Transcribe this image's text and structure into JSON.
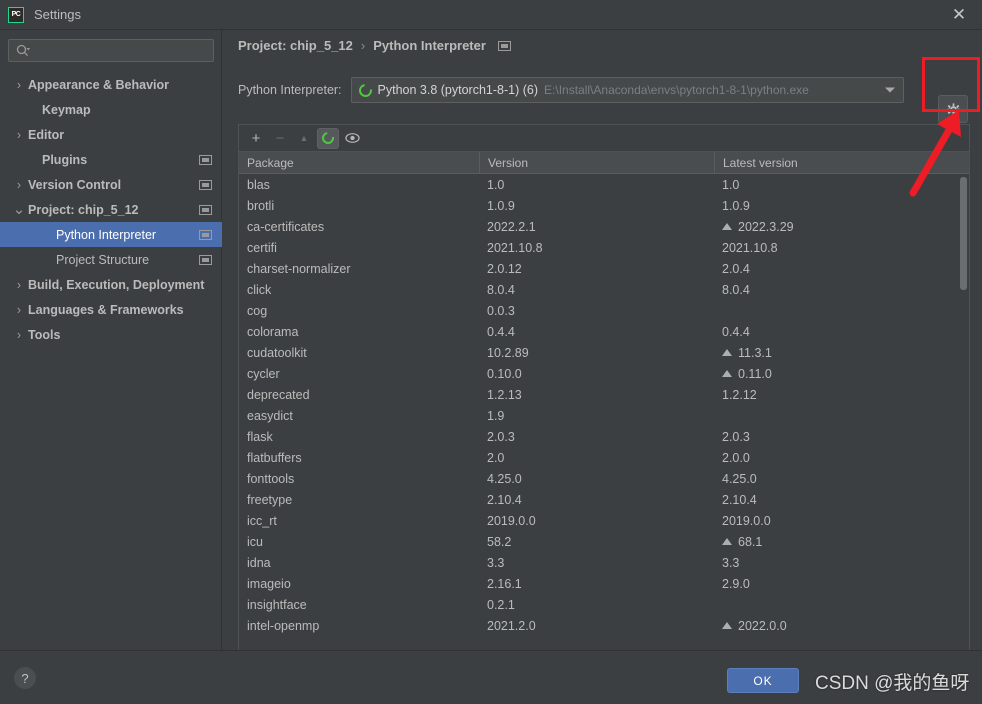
{
  "window": {
    "app_icon": "pycharm-logo-icon",
    "title": "Settings",
    "close_label": "✕"
  },
  "sidebar": {
    "search": {
      "placeholder": "",
      "value": "",
      "icon": "search-icon"
    },
    "items": [
      {
        "label": "Appearance & Behavior",
        "arrow": "›",
        "indent": 0,
        "bold": true,
        "scope_icon": false,
        "selected": false
      },
      {
        "label": "Keymap",
        "arrow": "",
        "indent": 1,
        "bold": true,
        "scope_icon": false,
        "selected": false
      },
      {
        "label": "Editor",
        "arrow": "›",
        "indent": 0,
        "bold": true,
        "scope_icon": false,
        "selected": false
      },
      {
        "label": "Plugins",
        "arrow": "",
        "indent": 1,
        "bold": true,
        "scope_icon": true,
        "selected": false
      },
      {
        "label": "Version Control",
        "arrow": "›",
        "indent": 0,
        "bold": true,
        "scope_icon": true,
        "selected": false
      },
      {
        "label": "Project: chip_5_12",
        "arrow": "⌄",
        "indent": 0,
        "bold": true,
        "scope_icon": true,
        "selected": false
      },
      {
        "label": "Python Interpreter",
        "arrow": "",
        "indent": 2,
        "bold": false,
        "scope_icon": true,
        "selected": true
      },
      {
        "label": "Project Structure",
        "arrow": "",
        "indent": 2,
        "bold": false,
        "scope_icon": true,
        "selected": false
      },
      {
        "label": "Build, Execution, Deployment",
        "arrow": "›",
        "indent": 0,
        "bold": true,
        "scope_icon": false,
        "selected": false
      },
      {
        "label": "Languages & Frameworks",
        "arrow": "›",
        "indent": 0,
        "bold": true,
        "scope_icon": false,
        "selected": false
      },
      {
        "label": "Tools",
        "arrow": "›",
        "indent": 0,
        "bold": true,
        "scope_icon": false,
        "selected": false
      }
    ]
  },
  "content": {
    "breadcrumb": {
      "root": "Project: chip_5_12",
      "separator": "›",
      "current": "Python Interpreter",
      "scope_icon": "project-scope-icon"
    },
    "interpreter": {
      "label": "Python Interpreter:",
      "icon": "conda-env-icon",
      "name": "Python 3.8 (pytorch1-8-1) (6)",
      "path": "E:\\Install\\Anaconda\\envs\\pytorch1-8-1\\python.exe",
      "dropdown_icon": "chevron-down-icon",
      "settings_icon": "gear-icon"
    },
    "toolbar": [
      {
        "icon": "plus-icon",
        "glyph": "+",
        "state": "enabled"
      },
      {
        "icon": "minus-icon",
        "glyph": "−",
        "state": "disabled"
      },
      {
        "icon": "upgrade-icon",
        "glyph": "▲",
        "state": "disabled"
      },
      {
        "icon": "conda-env-icon",
        "glyph": "",
        "state": "active"
      },
      {
        "icon": "eye-icon",
        "glyph": "",
        "state": "enabled"
      }
    ],
    "table": {
      "columns": [
        "Package",
        "Version",
        "Latest version"
      ],
      "rows": [
        {
          "package": "blas",
          "version": "1.0",
          "latest": "1.0",
          "upgrade": false
        },
        {
          "package": "brotli",
          "version": "1.0.9",
          "latest": "1.0.9",
          "upgrade": false
        },
        {
          "package": "ca-certificates",
          "version": "2022.2.1",
          "latest": "2022.3.29",
          "upgrade": true
        },
        {
          "package": "certifi",
          "version": "2021.10.8",
          "latest": "2021.10.8",
          "upgrade": false
        },
        {
          "package": "charset-normalizer",
          "version": "2.0.12",
          "latest": "2.0.4",
          "upgrade": false
        },
        {
          "package": "click",
          "version": "8.0.4",
          "latest": "8.0.4",
          "upgrade": false
        },
        {
          "package": "cog",
          "version": "0.0.3",
          "latest": "",
          "upgrade": false
        },
        {
          "package": "colorama",
          "version": "0.4.4",
          "latest": "0.4.4",
          "upgrade": false
        },
        {
          "package": "cudatoolkit",
          "version": "10.2.89",
          "latest": "11.3.1",
          "upgrade": true
        },
        {
          "package": "cycler",
          "version": "0.10.0",
          "latest": "0.11.0",
          "upgrade": true
        },
        {
          "package": "deprecated",
          "version": "1.2.13",
          "latest": "1.2.12",
          "upgrade": false
        },
        {
          "package": "easydict",
          "version": "1.9",
          "latest": "",
          "upgrade": false
        },
        {
          "package": "flask",
          "version": "2.0.3",
          "latest": "2.0.3",
          "upgrade": false
        },
        {
          "package": "flatbuffers",
          "version": "2.0",
          "latest": "2.0.0",
          "upgrade": false
        },
        {
          "package": "fonttools",
          "version": "4.25.0",
          "latest": "4.25.0",
          "upgrade": false
        },
        {
          "package": "freetype",
          "version": "2.10.4",
          "latest": "2.10.4",
          "upgrade": false
        },
        {
          "package": "icc_rt",
          "version": "2019.0.0",
          "latest": "2019.0.0",
          "upgrade": false
        },
        {
          "package": "icu",
          "version": "58.2",
          "latest": "68.1",
          "upgrade": true
        },
        {
          "package": "idna",
          "version": "3.3",
          "latest": "3.3",
          "upgrade": false
        },
        {
          "package": "imageio",
          "version": "2.16.1",
          "latest": "2.9.0",
          "upgrade": false
        },
        {
          "package": "insightface",
          "version": "0.2.1",
          "latest": "",
          "upgrade": false
        },
        {
          "package": "intel-openmp",
          "version": "2021.2.0",
          "latest": "2022.0.0",
          "upgrade": true
        }
      ]
    }
  },
  "footer": {
    "help_label": "?",
    "ok_label": "OK",
    "watermark": "CSDN @我的鱼呀"
  },
  "annotation": {
    "highlight_color": "#ee1c25",
    "target": "gear-button-highlight"
  }
}
